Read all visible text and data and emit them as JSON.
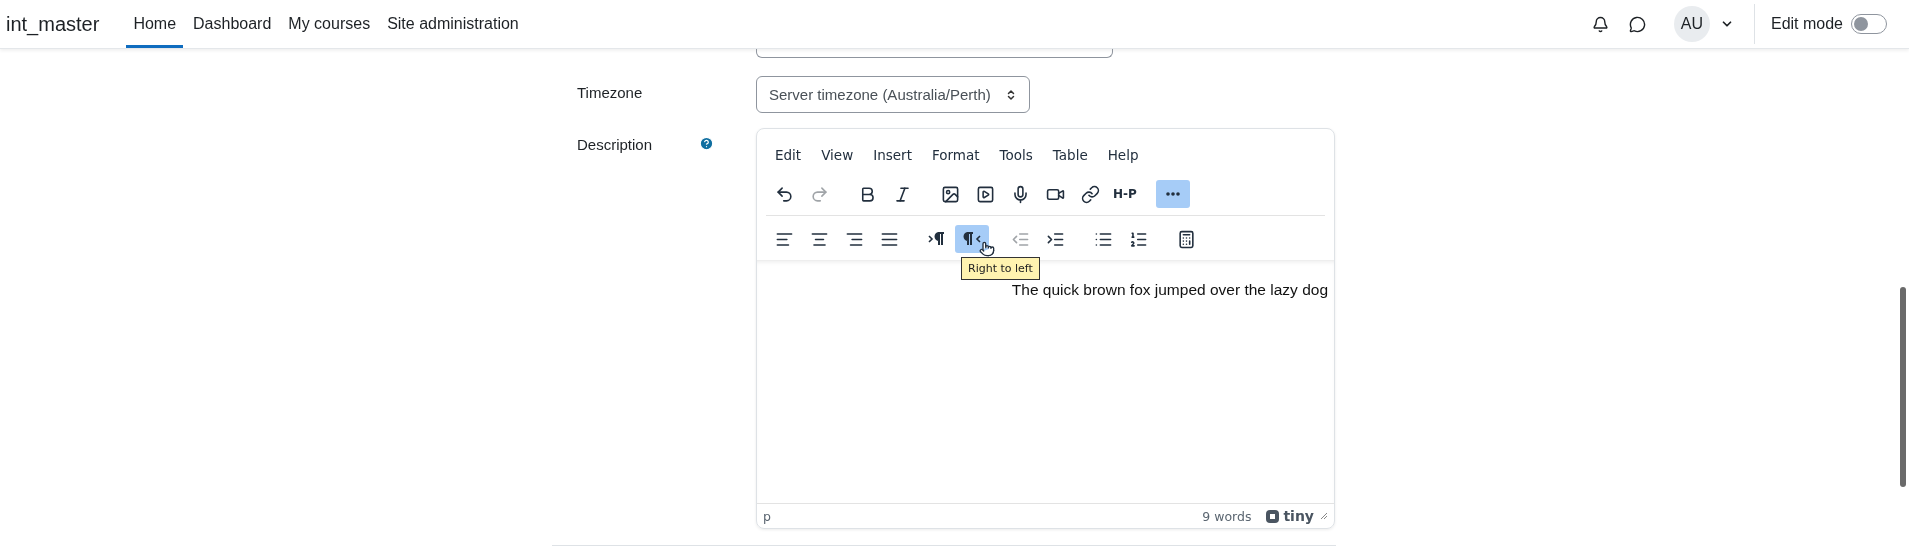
{
  "navbar": {
    "brand": "int_master",
    "items": [
      {
        "label": "Home",
        "selected": true
      },
      {
        "label": "Dashboard",
        "selected": false
      },
      {
        "label": "My courses",
        "selected": false
      },
      {
        "label": "Site administration",
        "selected": false
      }
    ],
    "avatar": "AU",
    "edit_mode": {
      "label": "Edit mode",
      "on": false
    }
  },
  "form": {
    "timezone": {
      "label": "Timezone",
      "value": "Server timezone (Australia/Perth)"
    },
    "description": {
      "label": "Description",
      "menu": [
        "Edit",
        "View",
        "Insert",
        "Format",
        "Tools",
        "Table",
        "Help"
      ],
      "toolbar_rows": [
        [
          {
            "kind": "undo",
            "disabled": false,
            "active": false
          },
          {
            "kind": "redo",
            "disabled": true,
            "active": false
          },
          {
            "kind": "bold",
            "disabled": false,
            "active": false
          },
          {
            "kind": "italic",
            "disabled": false,
            "active": false
          },
          {
            "kind": "image",
            "disabled": false,
            "active": false
          },
          {
            "kind": "media",
            "disabled": false,
            "active": false
          },
          {
            "kind": "audio",
            "disabled": false,
            "active": false
          },
          {
            "kind": "video",
            "disabled": false,
            "active": false
          },
          {
            "kind": "link",
            "disabled": false,
            "active": false
          },
          {
            "kind": "h5p",
            "label": "H-P",
            "disabled": false,
            "active": false
          },
          {
            "kind": "more",
            "disabled": false,
            "active": true
          }
        ],
        [
          {
            "kind": "alignleft",
            "disabled": false,
            "active": false
          },
          {
            "kind": "aligncenter",
            "disabled": false,
            "active": false
          },
          {
            "kind": "alignright",
            "disabled": false,
            "active": false
          },
          {
            "kind": "justify",
            "disabled": false,
            "active": false
          },
          {
            "kind": "ltr",
            "disabled": false,
            "active": false
          },
          {
            "kind": "rtl",
            "disabled": false,
            "active": true,
            "tooltip": "Right to left"
          },
          {
            "kind": "outdent",
            "disabled": true,
            "active": false
          },
          {
            "kind": "indent",
            "disabled": false,
            "active": false
          },
          {
            "kind": "bullets",
            "disabled": false,
            "active": false
          },
          {
            "kind": "numbers",
            "disabled": false,
            "active": false
          },
          {
            "kind": "calculator",
            "disabled": false,
            "active": false
          }
        ]
      ],
      "content": {
        "text": "The quick brown fox jumped over the lazy dog",
        "rtl": true
      },
      "status": {
        "path": "p",
        "words": "9 words",
        "brand": "tiny"
      }
    }
  }
}
